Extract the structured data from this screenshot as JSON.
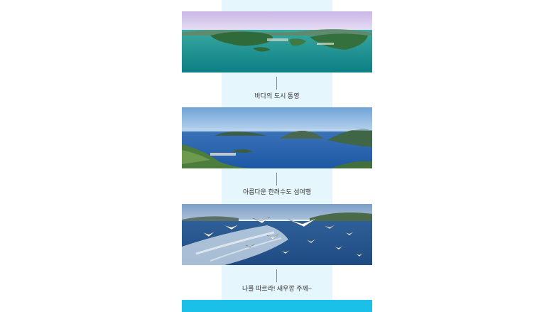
{
  "sections": [
    {
      "caption": "바다의 도시 통영",
      "image": "aerial-island-bay-photo"
    },
    {
      "caption": "아름다운 한려수도 섬여행",
      "image": "coastal-islands-photo"
    },
    {
      "caption": "나를 따르라! 새우깡 주께~",
      "image": "seagulls-over-sea-photo"
    }
  ],
  "colors": {
    "background_strip": "#e6f6fd",
    "bottom_bar": "#1bc0e8"
  }
}
